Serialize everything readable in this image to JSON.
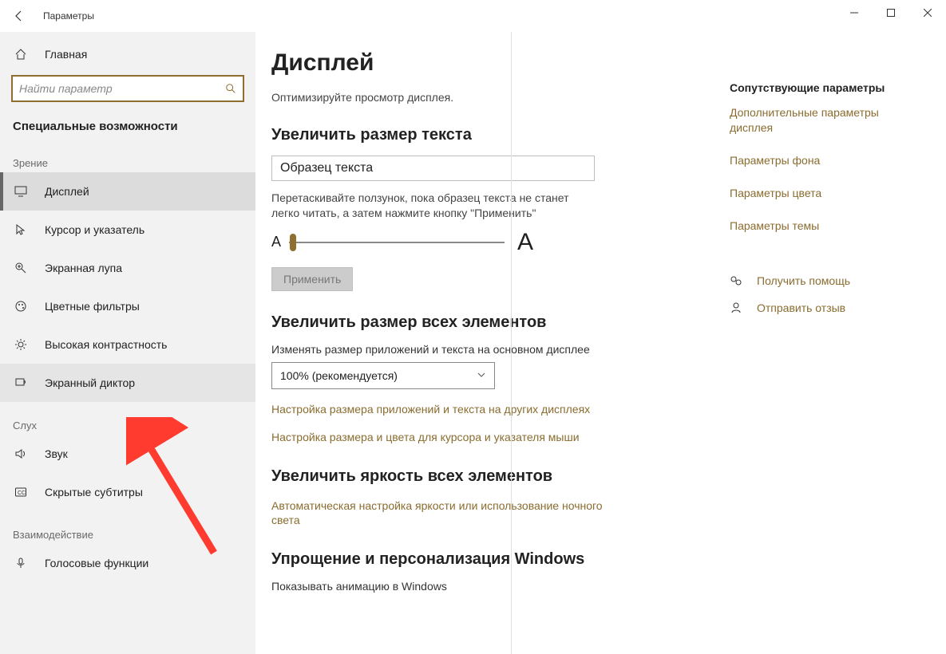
{
  "window": {
    "title": "Параметры"
  },
  "sidebar": {
    "home": "Главная",
    "search_placeholder": "Найти параметр",
    "category": "Специальные возможности",
    "groups": {
      "vision": "Зрение",
      "hearing": "Слух",
      "interaction": "Взаимодействие"
    },
    "items": {
      "display": "Дисплей",
      "cursor": "Курсор и указатель",
      "magnifier": "Экранная лупа",
      "color_filters": "Цветные фильтры",
      "high_contrast": "Высокая контрастность",
      "narrator": "Экранный диктор",
      "audio": "Звук",
      "captions": "Скрытые субтитры",
      "speech": "Голосовые функции"
    }
  },
  "main": {
    "title": "Дисплей",
    "subtitle": "Оптимизируйте просмотр дисплея.",
    "section_text_size": "Увеличить размер текста",
    "sample_text": "Образец текста",
    "slider_desc": "Перетаскивайте ползунок, пока образец текста не станет легко читать, а затем нажмите кнопку \"Применить\"",
    "apply": "Применить",
    "section_scale": "Увеличить размер всех элементов",
    "scale_label": "Изменять размер приложений и текста на основном дисплее",
    "scale_value": "100% (рекомендуется)",
    "link_other_displays": "Настройка размера приложений и текста на других дисплеях",
    "link_cursor": "Настройка размера и цвета для курсора и указателя мыши",
    "section_brightness": "Увеличить яркость всех элементов",
    "link_brightness": "Автоматическая настройка яркости или использование ночного света",
    "section_simplify": "Упрощение и персонализация Windows",
    "toggle_anim": "Показывать анимацию в Windows"
  },
  "rail": {
    "related_heading": "Сопутствующие параметры",
    "adv_display": "Дополнительные параметры дисплея",
    "bg": "Параметры фона",
    "color": "Параметры цвета",
    "theme": "Параметры темы",
    "help": "Получить помощь",
    "feedback": "Отправить отзыв"
  }
}
